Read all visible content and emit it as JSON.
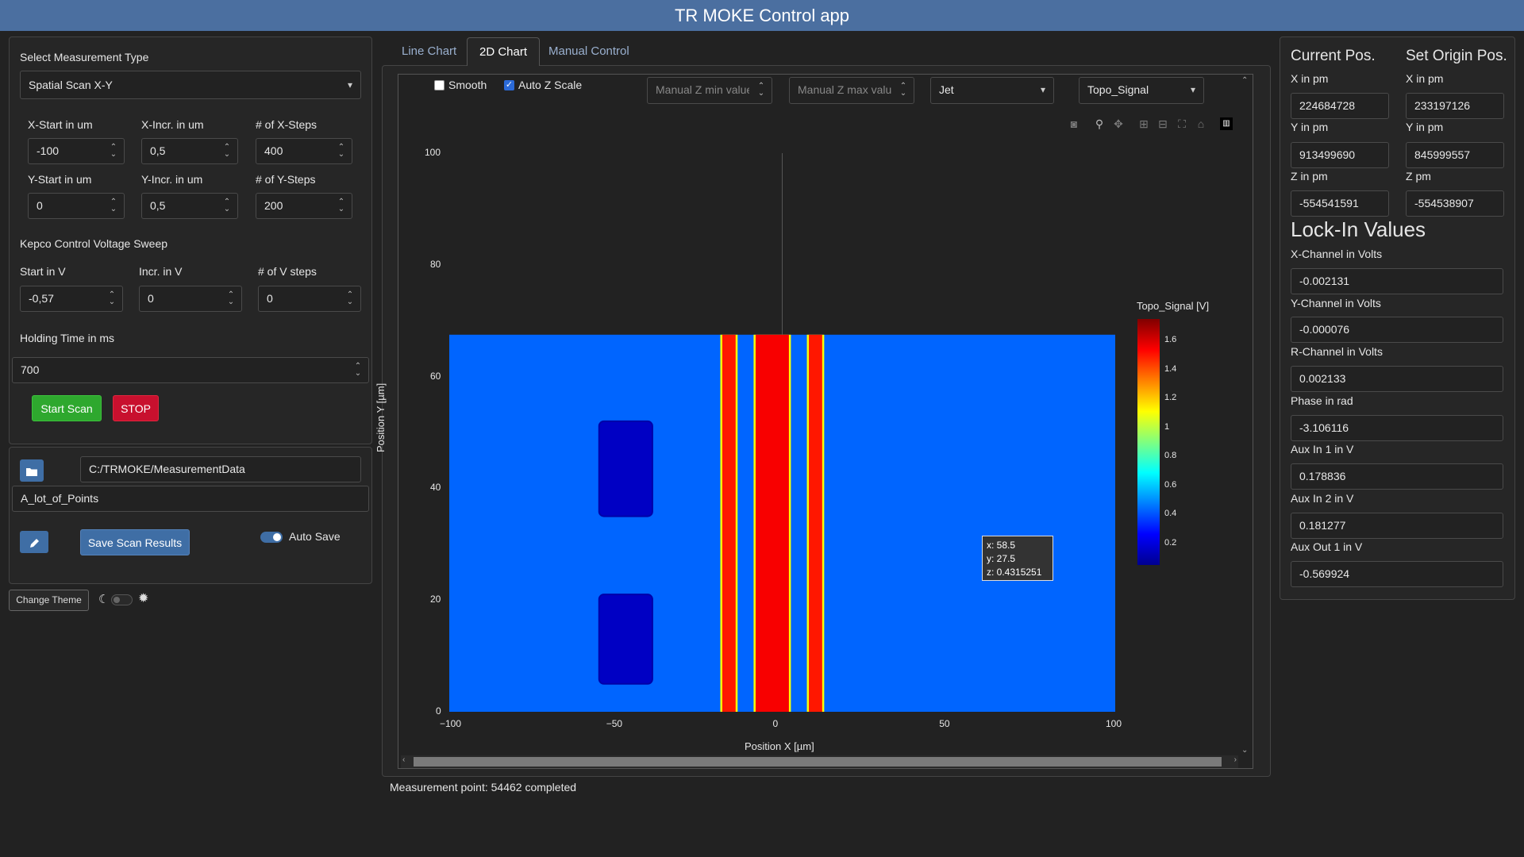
{
  "app": {
    "title": "TR MOKE Control app"
  },
  "scan": {
    "measurement_type_label": "Select Measurement Type",
    "measurement_type_value": "Spatial Scan X-Y",
    "x_start_label": "X-Start in um",
    "x_start": "-100",
    "x_incr_label": "X-Incr. in um",
    "x_incr": "0,5",
    "x_steps_label": "# of X-Steps",
    "x_steps": "400",
    "y_start_label": "Y-Start in um",
    "y_start": "0",
    "y_incr_label": "Y-Incr. in um",
    "y_incr": "0,5",
    "y_steps_label": "# of Y-Steps",
    "y_steps": "200",
    "kepco_label": "Kepco Control Voltage Sweep",
    "v_start_label": "Start in V",
    "v_start": "-0,57",
    "v_incr_label": "Incr. in V",
    "v_incr": "0",
    "v_steps_label": "# of V steps",
    "v_steps": "0",
    "holding_label": "Holding Time in ms",
    "holding": "700",
    "start_button": "Start Scan",
    "stop_button": "STOP"
  },
  "save": {
    "path": "C:/TRMOKE/MeasurementData",
    "filename": "A_lot_of_Points",
    "save_button": "Save Scan Results",
    "auto_save_label": "Auto Save"
  },
  "theme": {
    "change_label": "Change Theme"
  },
  "tabs": [
    {
      "label": "Line Chart"
    },
    {
      "label": "2D Chart"
    },
    {
      "label": "Manual Control"
    }
  ],
  "chart_controls": {
    "smooth_label": "Smooth",
    "auto_z_label": "Auto Z Scale",
    "z_min_placeholder": "Manual Z min value",
    "z_max_placeholder": "Manual Z max value",
    "colormap": "Jet",
    "signal": "Topo_Signal"
  },
  "chart_data": {
    "type": "heatmap",
    "xlabel": "Position X [µm]",
    "ylabel": "Position Y [µm]",
    "xlim": [
      -100,
      100
    ],
    "ylim": [
      0,
      100
    ],
    "x_ticks": [
      "−100",
      "−50",
      "0",
      "50",
      "100"
    ],
    "y_ticks": [
      "0",
      "20",
      "40",
      "60",
      "80",
      "100"
    ],
    "data_extent": {
      "x": [
        -100,
        100
      ],
      "y": [
        0,
        67.5
      ]
    },
    "colorbar_title": "Topo_Signal [V]",
    "colorbar_ticks": [
      "0.2",
      "0.4",
      "0.6",
      "0.8",
      "1",
      "1.2",
      "1.4",
      "1.6"
    ],
    "colorscale": "Jet",
    "zlim": [
      0.05,
      1.75
    ],
    "background_value": 0.43,
    "stripes": [
      {
        "x_center": -16,
        "width": 4,
        "value": 1.5
      },
      {
        "x_center": -3,
        "width": 10,
        "value": 1.55
      },
      {
        "x_center": 10,
        "width": 4,
        "value": 1.5
      }
    ],
    "pads": [
      {
        "x": [
          -55,
          -39
        ],
        "y": [
          35,
          52
        ],
        "value": 0.15
      },
      {
        "x": [
          -55,
          -39
        ],
        "y": [
          5,
          21
        ],
        "value": 0.15
      }
    ],
    "hover": {
      "x": "x: 58.5",
      "y": "y: 27.5",
      "z": "z: 0.4315251"
    },
    "crosshair_x": 0
  },
  "status": {
    "message": "Measurement point: 54462 completed"
  },
  "position": {
    "current_title": "Current Pos.",
    "origin_title": "Set Origin Pos.",
    "x_label": "X in pm",
    "y_label": "Y in pm",
    "z_label_current": "Z in pm",
    "z_label_origin": "Z pm",
    "current": {
      "x": "224684728",
      "y": "913499690",
      "z": "-554541591"
    },
    "origin": {
      "x": "233197126",
      "y": "845999557",
      "z": "-554538907"
    }
  },
  "lockin": {
    "title": "Lock-In Values",
    "fields": [
      {
        "label": "X-Channel in Volts",
        "value": "-0.002131"
      },
      {
        "label": "Y-Channel in Volts",
        "value": "-0.000076"
      },
      {
        "label": "R-Channel in Volts",
        "value": "0.002133"
      },
      {
        "label": "Phase in rad",
        "value": "-3.106116"
      },
      {
        "label": "Aux In 1 in V",
        "value": "0.178836"
      },
      {
        "label": "Aux In 2 in V",
        "value": "0.181277"
      },
      {
        "label": "Aux Out 1 in V",
        "value": "-0.569924"
      }
    ]
  }
}
